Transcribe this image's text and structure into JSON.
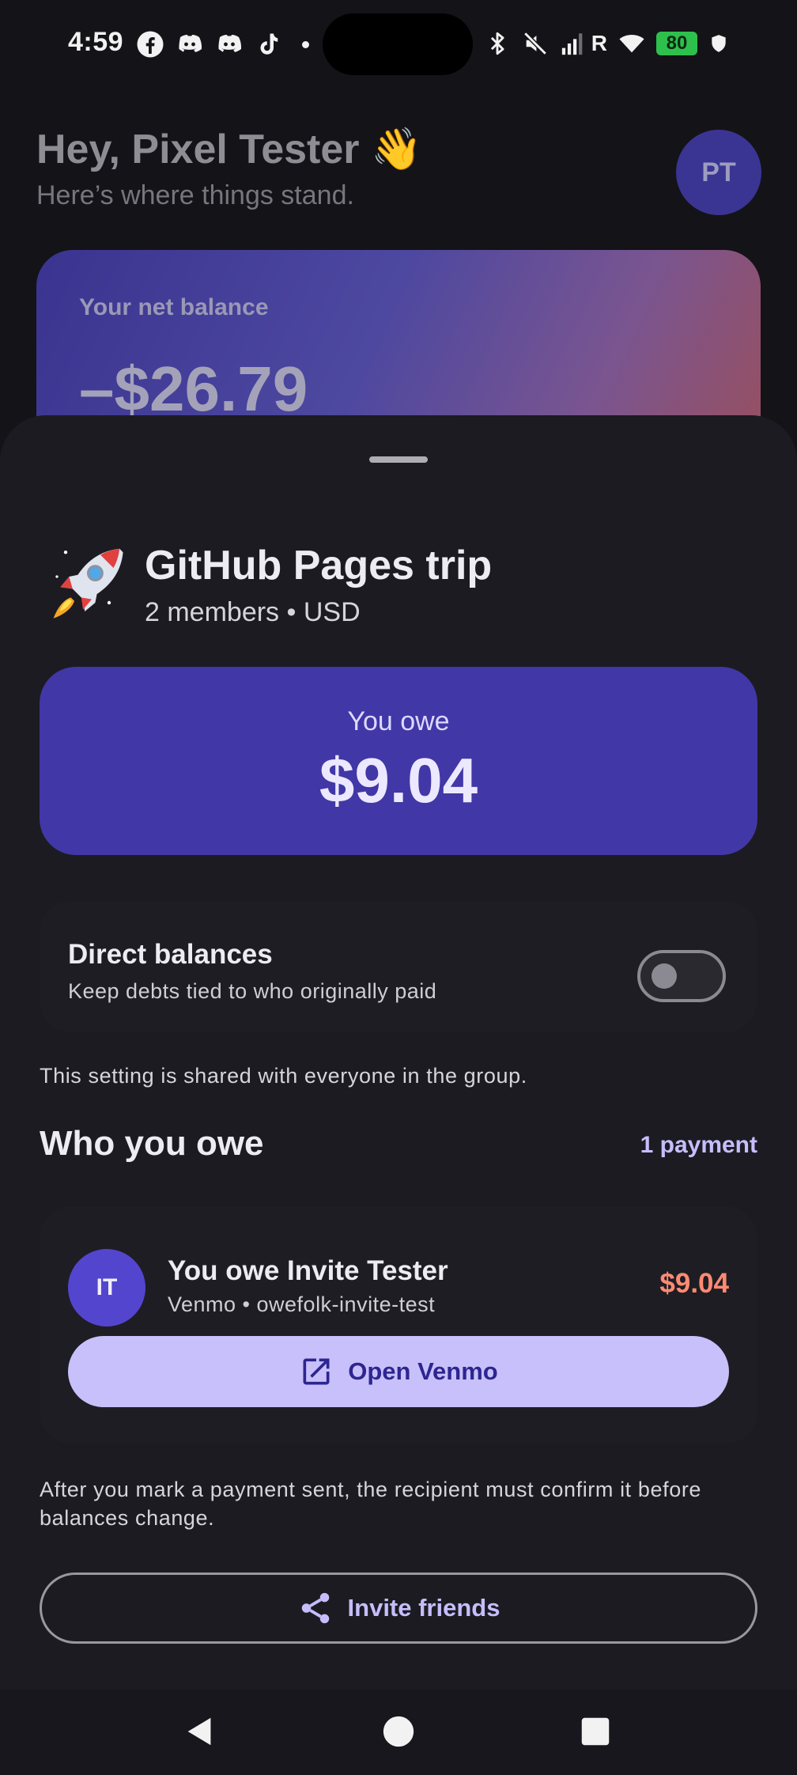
{
  "status_bar": {
    "time": "4:59",
    "battery": "80",
    "network_letter": "R",
    "left_icons": [
      "facebook-icon",
      "discord-icon",
      "discord-icon",
      "tiktok-icon",
      "dot-icon"
    ],
    "right_icons": [
      "bluetooth-icon",
      "mute-icon",
      "signal-icon",
      "wifi-icon",
      "battery-icon",
      "shield-icon"
    ]
  },
  "background": {
    "greeting": "Hey, Pixel Tester 👋",
    "subgreeting": "Here’s where things stand.",
    "avatar_initials": "PT",
    "balance_label": "Your net balance",
    "balance_value": "–$26.79"
  },
  "sheet": {
    "group": {
      "emoji_icon": "rocket-icon",
      "title": "GitHub Pages trip",
      "meta": "2 members • USD"
    },
    "owe_card": {
      "label": "You owe",
      "amount": "$9.04"
    },
    "direct_balances": {
      "title": "Direct balances",
      "subtitle": "Keep debts tied to who originally paid",
      "enabled": false
    },
    "shared_note": "This setting is shared with everyone in the group.",
    "who_you_owe": {
      "title": "Who you owe",
      "count": "1 payment",
      "payments": [
        {
          "initials": "IT",
          "title": "You owe Invite Tester",
          "subtitle": "Venmo • owefolk-invite-test",
          "amount": "$9.04",
          "button_label": "Open Venmo"
        }
      ]
    },
    "confirm_note": "After you mark a payment sent, the recipient must confirm it before balances change.",
    "invite_label": "Invite friends"
  },
  "colors": {
    "accent": "#4137a6",
    "accent_light": "#c7c0fb",
    "debt": "#ff8a73",
    "sheet_bg": "#1c1b21"
  }
}
